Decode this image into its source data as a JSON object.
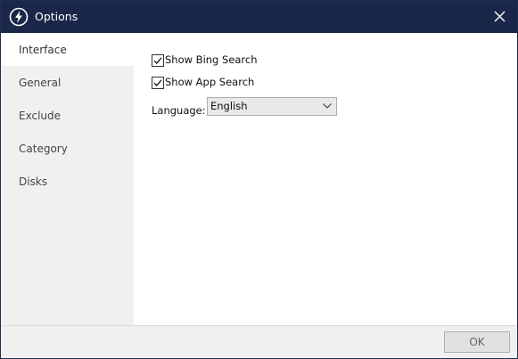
{
  "window": {
    "title": "Options",
    "app_icon": "lightning-bolt-icon",
    "close_icon": "close-icon"
  },
  "sidebar": {
    "items": [
      {
        "label": "Interface",
        "active": true
      },
      {
        "label": "General",
        "active": false
      },
      {
        "label": "Exclude",
        "active": false
      },
      {
        "label": "Category",
        "active": false
      },
      {
        "label": "Disks",
        "active": false
      }
    ]
  },
  "interface": {
    "show_bing_search": {
      "label": "Show Bing Search",
      "checked": true
    },
    "show_app_search": {
      "label": "Show App Search",
      "checked": true
    },
    "language": {
      "label": "Language:",
      "value": "English"
    }
  },
  "footer": {
    "ok_label": "OK"
  },
  "colors": {
    "titlebar": "#1a2749",
    "sidebar": "#f0f0f0",
    "footer": "#f0f0f0"
  }
}
